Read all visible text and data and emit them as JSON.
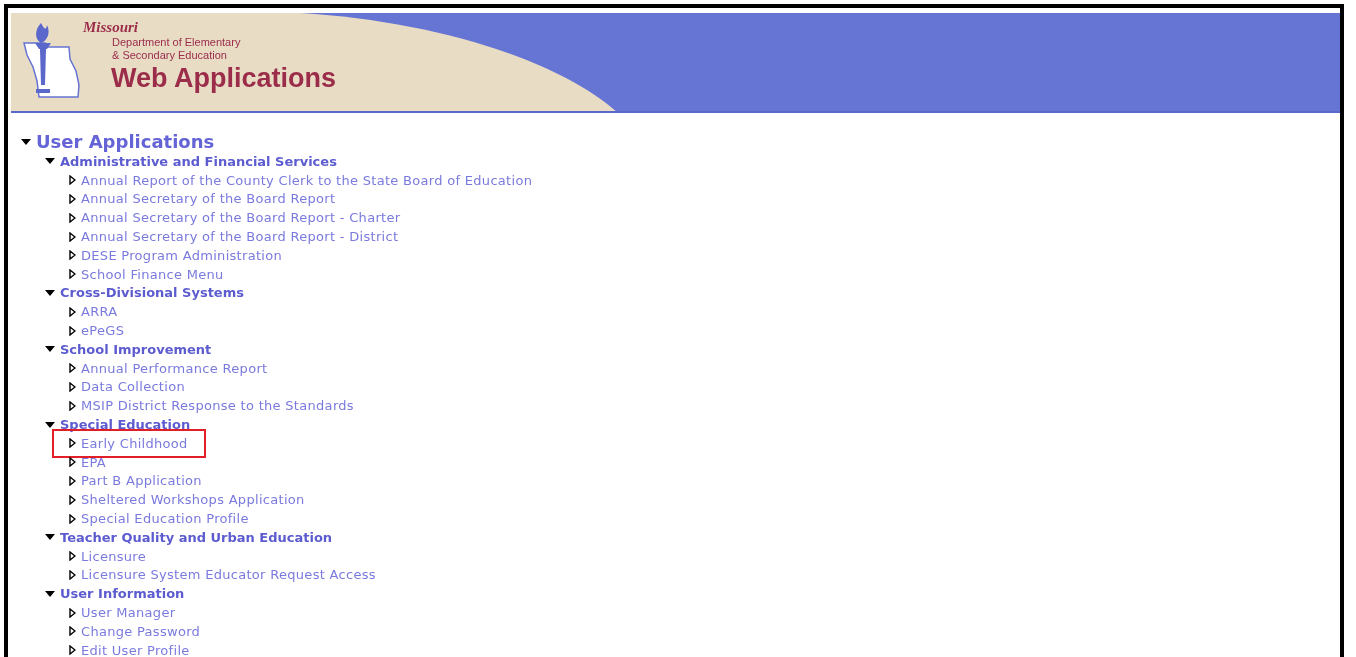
{
  "header": {
    "state": "Missouri",
    "department_lines": [
      "Department of Elementary",
      "& Secondary Education"
    ],
    "title": "Web Applications"
  },
  "tree": {
    "label": "User Applications",
    "expanded": true,
    "children": [
      {
        "label": "Administrative and Financial Services",
        "expanded": true,
        "children": [
          {
            "label": "Annual Report of the County Clerk to the State Board of Education",
            "expanded": false,
            "highlighted": false
          },
          {
            "label": "Annual Secretary of the Board Report",
            "expanded": false,
            "highlighted": false
          },
          {
            "label": "Annual Secretary of the Board Report - Charter",
            "expanded": false,
            "highlighted": false
          },
          {
            "label": "Annual Secretary of the Board Report - District",
            "expanded": false,
            "highlighted": false
          },
          {
            "label": "DESE Program Administration",
            "expanded": false,
            "highlighted": false
          },
          {
            "label": "School Finance Menu",
            "expanded": false,
            "highlighted": false
          }
        ]
      },
      {
        "label": "Cross-Divisional Systems",
        "expanded": true,
        "children": [
          {
            "label": "ARRA",
            "expanded": false,
            "highlighted": false
          },
          {
            "label": "ePeGS",
            "expanded": false,
            "highlighted": false
          }
        ]
      },
      {
        "label": "School Improvement",
        "expanded": true,
        "children": [
          {
            "label": "Annual Performance Report",
            "expanded": false,
            "highlighted": false
          },
          {
            "label": "Data Collection",
            "expanded": false,
            "highlighted": false
          },
          {
            "label": "MSIP District Response to the Standards",
            "expanded": false,
            "highlighted": false
          }
        ]
      },
      {
        "label": "Special Education",
        "expanded": true,
        "children": [
          {
            "label": "Early Childhood",
            "expanded": false,
            "highlighted": true
          },
          {
            "label": "EPA",
            "expanded": false,
            "highlighted": false
          },
          {
            "label": "Part B Application",
            "expanded": false,
            "highlighted": false
          },
          {
            "label": "Sheltered Workshops Application",
            "expanded": false,
            "highlighted": false
          },
          {
            "label": "Special Education Profile",
            "expanded": false,
            "highlighted": false
          }
        ]
      },
      {
        "label": "Teacher Quality and Urban Education",
        "expanded": true,
        "children": [
          {
            "label": "Licensure",
            "expanded": false,
            "highlighted": false
          },
          {
            "label": "Licensure System Educator Request Access",
            "expanded": false,
            "highlighted": false
          }
        ]
      },
      {
        "label": "User Information",
        "expanded": true,
        "children": [
          {
            "label": "User Manager",
            "expanded": false,
            "highlighted": false
          },
          {
            "label": "Change Password",
            "expanded": false,
            "highlighted": false
          },
          {
            "label": "Edit User Profile",
            "expanded": false,
            "highlighted": false
          }
        ]
      }
    ]
  }
}
